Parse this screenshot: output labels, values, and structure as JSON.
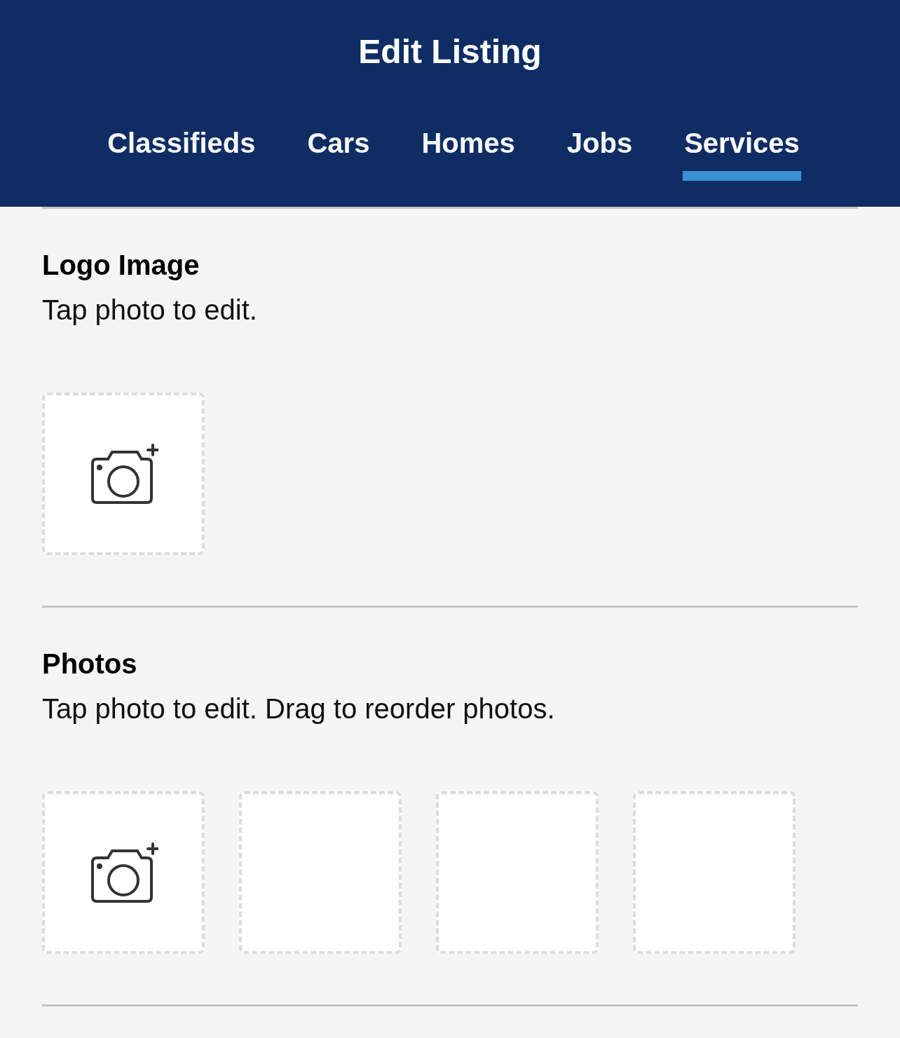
{
  "header": {
    "title": "Edit Listing"
  },
  "tabs": [
    {
      "label": "Classifieds",
      "selected": false
    },
    {
      "label": "Cars",
      "selected": false
    },
    {
      "label": "Homes",
      "selected": false
    },
    {
      "label": "Jobs",
      "selected": false
    },
    {
      "label": "Services",
      "selected": true
    }
  ],
  "sections": [
    {
      "title": "Logo Image",
      "hint": "Tap photo to edit.",
      "slots": [
        {
          "kind": "add"
        }
      ]
    },
    {
      "title": "Photos",
      "hint": "Tap photo to edit. Drag to reorder photos.",
      "slots": [
        {
          "kind": "add"
        },
        {
          "kind": "empty"
        },
        {
          "kind": "empty"
        },
        {
          "kind": "empty"
        }
      ]
    }
  ]
}
